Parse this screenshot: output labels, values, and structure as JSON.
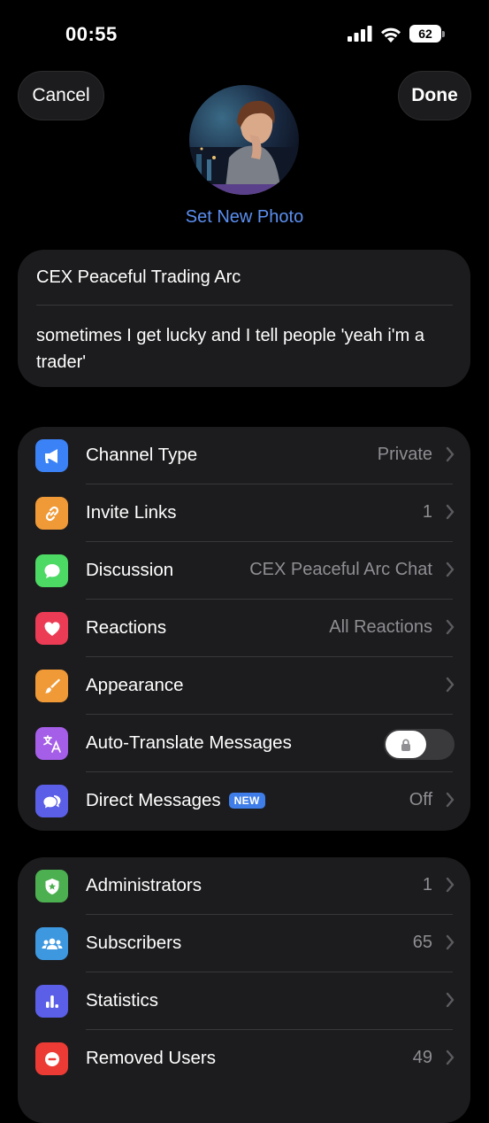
{
  "status": {
    "time": "00:55",
    "battery": "62"
  },
  "nav": {
    "cancel_label": "Cancel",
    "done_label": "Done"
  },
  "photo": {
    "set_label": "Set New Photo"
  },
  "info": {
    "name": "CEX Peaceful Trading Arc",
    "description": "sometimes I get lucky and I tell people 'yeah i'm a trader'"
  },
  "settings": [
    {
      "label": "Channel Type",
      "value": "Private",
      "icon": "megaphone-icon",
      "color": "#3b82f6"
    },
    {
      "label": "Invite Links",
      "value": "1",
      "icon": "link-icon",
      "color": "#f09a37"
    },
    {
      "label": "Discussion",
      "value": "CEX Peaceful Arc Chat",
      "icon": "chat-bubble-icon",
      "color": "#4cd964"
    },
    {
      "label": "Reactions",
      "value": "All Reactions",
      "icon": "heart-icon",
      "color": "#ec3b54"
    },
    {
      "label": "Appearance",
      "value": "",
      "icon": "paintbrush-icon",
      "color": "#f09a37"
    },
    {
      "label": "Auto-Translate Messages",
      "value": "",
      "icon": "translate-icon",
      "color": "#a55ee8"
    },
    {
      "label": "Direct Messages",
      "badge": "NEW",
      "value": "Off",
      "icon": "messages-icon",
      "color": "#5b5fe8"
    }
  ],
  "admin": [
    {
      "label": "Administrators",
      "value": "1",
      "icon": "admin-badge-icon",
      "color": "#4cb050"
    },
    {
      "label": "Subscribers",
      "value": "65",
      "icon": "people-icon",
      "color": "#3d98e0"
    },
    {
      "label": "Statistics",
      "value": "",
      "icon": "bar-chart-icon",
      "color": "#5b5fe8"
    },
    {
      "label": "Removed Users",
      "value": "49",
      "icon": "removed-icon",
      "color": "#ec3b34"
    }
  ]
}
